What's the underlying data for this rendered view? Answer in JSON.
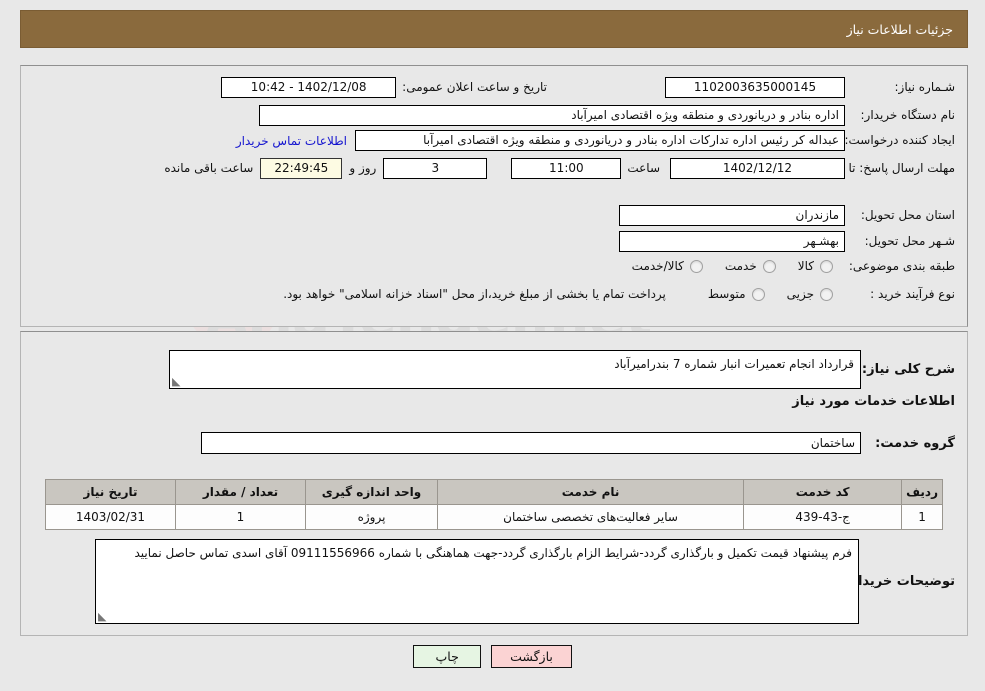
{
  "header": {
    "title": "جزئیات اطلاعات نیاز"
  },
  "top": {
    "need_number_label": "شـماره نیاز:",
    "need_number_value": "1102003635000145",
    "announce_label": "تاریخ و ساعت اعلان عمومی:",
    "announce_value": "1402/12/08 - 10:42",
    "buyer_org_label": "نام دستگاه خریدار:",
    "buyer_org_value": "اداره بنادر و دریانوردی و منطقه ویژه اقتصادی امیرآباد",
    "creator_label": "ایجاد کننده درخواست:",
    "creator_value": "عبداله کر رئیس اداره تدارکات اداره بنادر و دریانوردی و منطقه ویژه اقتصادی امیرآبا",
    "contact_link": "اطلاعات تماس خریدار",
    "deadline_label": "مهلت ارسال پاسخ: تا تاریخ:",
    "deadline_date": "1402/12/12",
    "hour_label": "ساعت",
    "hour_value": "11:00",
    "days_value": "3",
    "days_label": "روز و",
    "timer_value": "22:49:45",
    "remaining_label": "ساعت باقی مانده",
    "province_label": "استان محل تحویل:",
    "province_value": "مازندران",
    "city_label": "شـهر محل تحویل:",
    "city_value": "بهشـهر",
    "category_label": "طبقه بندی موضوعی:",
    "category_options": [
      {
        "label": "کالا",
        "selected": false
      },
      {
        "label": "خدمت",
        "selected": false
      },
      {
        "label": "کالا/خدمت",
        "selected": false
      }
    ],
    "process_label": "نوع فرآیند خرید :",
    "process_options": [
      {
        "label": "جزیی",
        "selected": false
      },
      {
        "label": "متوسط",
        "selected": false
      }
    ],
    "process_note": "پرداخت تمام یا بخشی از مبلغ خرید،از محل \"اسناد خزانه اسلامی\" خواهد بود."
  },
  "mid": {
    "summary_label": "شرح کلی نیاز:",
    "summary_value": "قرارداد انجام تعمیرات انبار شماره 7 بندرامیرآباد",
    "services_title": "اطلاعات خدمات مورد نیاز",
    "service_group_label": "گروه خدمت:",
    "service_group_value": "ساختمان",
    "table": {
      "headers": [
        "ردیف",
        "کد خدمت",
        "نام خدمت",
        "واحد اندازه گیری",
        "تعداد / مقدار",
        "تاریخ نیاز"
      ],
      "rows": [
        [
          "1",
          "ج-43-439",
          "سایر فعالیت‌های تخصصی ساختمان",
          "پروژه",
          "1",
          "1403/02/31"
        ]
      ]
    },
    "buyer_notes_label": "توضیحات خریدار:",
    "buyer_notes_value": "فرم پیشنهاد قیمت تکمیل و بارگذاری گردد-شرایط الزام بارگذاری گردد-جهت هماهنگی با شماره 09111556966 آقای اسدی تماس حاصل نمایید"
  },
  "footer": {
    "back_label": "بازگشت",
    "print_label": "چاپ"
  },
  "watermark": {
    "text": "AriaTender.net"
  },
  "colors": {
    "header_bg": "#8a6a3d",
    "link": "#1414cf",
    "timer_bg": "#fdfbe3",
    "back_btn_bg": "#fbd3d3",
    "print_btn_bg": "#e6f5e3"
  }
}
